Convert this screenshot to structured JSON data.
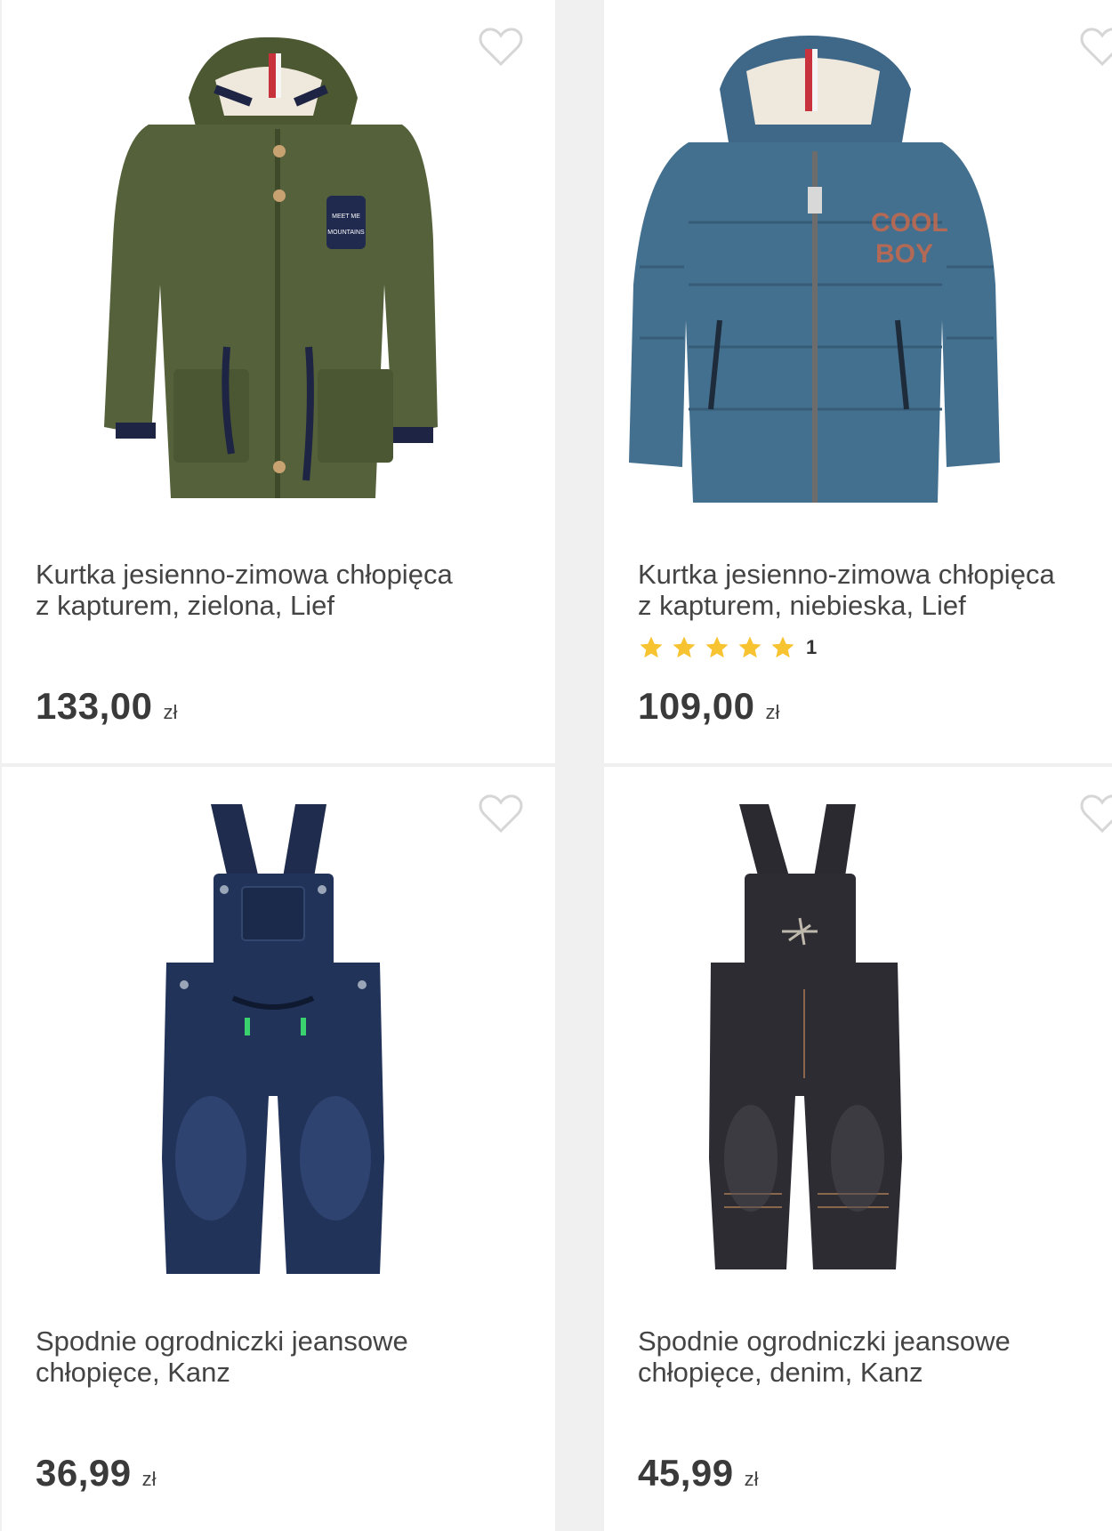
{
  "products": [
    {
      "title_line1": "Kurtka jesienno-zimowa chłopięca",
      "title_line2": "z kapturem, zielona, Lief",
      "price": "133,00",
      "currency": "zł",
      "image": "green-parka-jacket",
      "color": "#4f5b34"
    },
    {
      "title_line1": "Kurtka jesienno-zimowa chłopięca",
      "title_line2": "z kapturem, niebieska, Lief",
      "price": "109,00",
      "currency": "zł",
      "rating": {
        "stars": 5,
        "count": "1"
      },
      "image": "blue-puffer-jacket",
      "color": "#3f6888"
    },
    {
      "title_line1": "Spodnie ogrodniczki jeansowe",
      "title_line2": "chłopięce, Kanz",
      "price": "36,99",
      "currency": "zł",
      "image": "dark-blue-denim-overalls",
      "color": "#1c2a4a"
    },
    {
      "title_line1": "Spodnie ogrodniczki jeansowe",
      "title_line2": "chłopięce, denim, Kanz",
      "price": "45,99",
      "currency": "zł",
      "image": "black-denim-overalls",
      "color": "#25242a"
    }
  ],
  "icons": {
    "favorite": "heart-outline-icon",
    "rating": "star-icon"
  },
  "colors": {
    "star": "#f7c331",
    "heart": "#d6d6d6",
    "text": "#444444",
    "background": "#f0f0f0"
  }
}
